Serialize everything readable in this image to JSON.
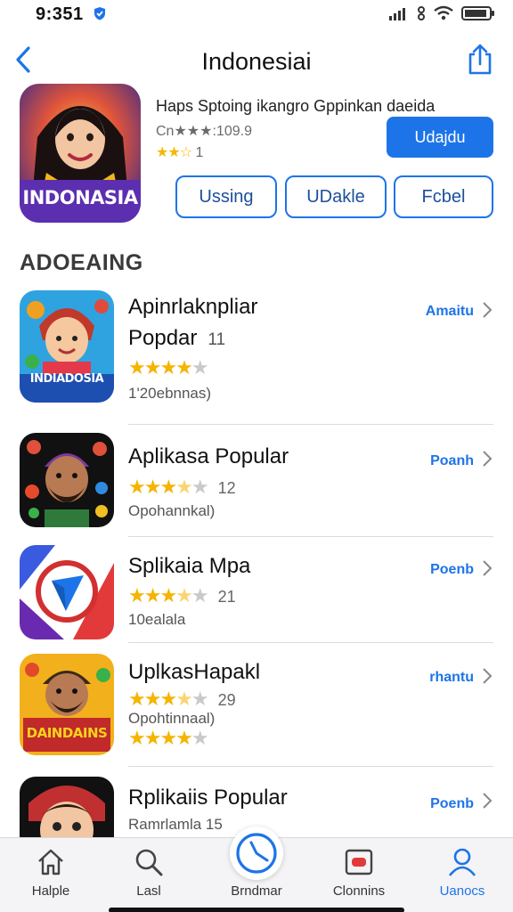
{
  "status_bar": {
    "time": "9:351"
  },
  "nav": {
    "title": "Indonesiai"
  },
  "featured": {
    "title": "Haps Sptoing ikangro Gppinkan daeida",
    "subtitle": "Cn★★★:109.9",
    "rating_count": "1",
    "primary_button": "Udajdu",
    "buttons": [
      "Ussing",
      "UDakle",
      "Fcbel"
    ],
    "icon_text": "INDONASIA"
  },
  "section": {
    "title": "ADOEAING"
  },
  "apps": [
    {
      "name": "Apinrlaknpliar",
      "name2": "Popdar",
      "count": "11",
      "stars": 4,
      "second_stars": null,
      "sub": "1'20ebnnas)",
      "action": "Amaitu",
      "icon_text": "INDIADOSIA"
    },
    {
      "name": "Aplikasa Popular",
      "name2": "",
      "count": "12",
      "stars": 3.5,
      "second_stars": null,
      "sub": "Opohannkal)",
      "action": "Poanh",
      "icon_text": ""
    },
    {
      "name": "Splikaia Mpa",
      "name2": "",
      "count": "21",
      "stars": 3.5,
      "second_stars": null,
      "sub": "10ealala",
      "action": "Poenb",
      "icon_text": ""
    },
    {
      "name": "UplkasHapakl",
      "name2": "",
      "count": "29",
      "stars": 3.5,
      "second_stars": 4,
      "sub": "Opohtinnaal)",
      "action": "rhantu",
      "icon_text": "DAINDAINS"
    },
    {
      "name": "Rplikaiis Popular",
      "name2": "",
      "count": "",
      "stars": null,
      "second_stars": null,
      "sub": "Ramrlamla 15",
      "action": "Poenb",
      "icon_text": ""
    }
  ],
  "tabs": [
    {
      "label": "Halple",
      "icon": "home-icon",
      "active": false
    },
    {
      "label": "Lasl",
      "icon": "search-icon",
      "active": false
    },
    {
      "label": "Brndmar",
      "icon": "compass-icon",
      "active": false
    },
    {
      "label": "Clonnins",
      "icon": "media-icon",
      "active": false
    },
    {
      "label": "Uanocs",
      "icon": "user-icon",
      "active": true
    }
  ],
  "colors": {
    "accent": "#1d74e8",
    "star": "#f5b400"
  }
}
